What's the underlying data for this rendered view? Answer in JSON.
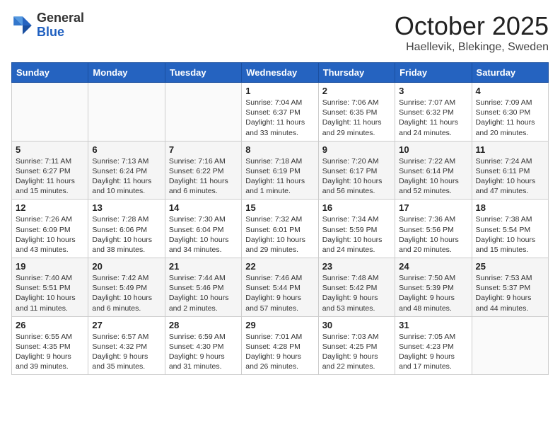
{
  "header": {
    "logo_general": "General",
    "logo_blue": "Blue",
    "month": "October 2025",
    "location": "Haellevik, Blekinge, Sweden"
  },
  "days_of_week": [
    "Sunday",
    "Monday",
    "Tuesday",
    "Wednesday",
    "Thursday",
    "Friday",
    "Saturday"
  ],
  "weeks": [
    {
      "shade": "white",
      "cells": [
        {
          "day": "",
          "empty": true,
          "text": ""
        },
        {
          "day": "",
          "empty": true,
          "text": ""
        },
        {
          "day": "",
          "empty": true,
          "text": ""
        },
        {
          "day": "1",
          "empty": false,
          "text": "Sunrise: 7:04 AM\nSunset: 6:37 PM\nDaylight: 11 hours\nand 33 minutes."
        },
        {
          "day": "2",
          "empty": false,
          "text": "Sunrise: 7:06 AM\nSunset: 6:35 PM\nDaylight: 11 hours\nand 29 minutes."
        },
        {
          "day": "3",
          "empty": false,
          "text": "Sunrise: 7:07 AM\nSunset: 6:32 PM\nDaylight: 11 hours\nand 24 minutes."
        },
        {
          "day": "4",
          "empty": false,
          "text": "Sunrise: 7:09 AM\nSunset: 6:30 PM\nDaylight: 11 hours\nand 20 minutes."
        }
      ]
    },
    {
      "shade": "gray",
      "cells": [
        {
          "day": "5",
          "empty": false,
          "text": "Sunrise: 7:11 AM\nSunset: 6:27 PM\nDaylight: 11 hours\nand 15 minutes."
        },
        {
          "day": "6",
          "empty": false,
          "text": "Sunrise: 7:13 AM\nSunset: 6:24 PM\nDaylight: 11 hours\nand 10 minutes."
        },
        {
          "day": "7",
          "empty": false,
          "text": "Sunrise: 7:16 AM\nSunset: 6:22 PM\nDaylight: 11 hours\nand 6 minutes."
        },
        {
          "day": "8",
          "empty": false,
          "text": "Sunrise: 7:18 AM\nSunset: 6:19 PM\nDaylight: 11 hours\nand 1 minute."
        },
        {
          "day": "9",
          "empty": false,
          "text": "Sunrise: 7:20 AM\nSunset: 6:17 PM\nDaylight: 10 hours\nand 56 minutes."
        },
        {
          "day": "10",
          "empty": false,
          "text": "Sunrise: 7:22 AM\nSunset: 6:14 PM\nDaylight: 10 hours\nand 52 minutes."
        },
        {
          "day": "11",
          "empty": false,
          "text": "Sunrise: 7:24 AM\nSunset: 6:11 PM\nDaylight: 10 hours\nand 47 minutes."
        }
      ]
    },
    {
      "shade": "white",
      "cells": [
        {
          "day": "12",
          "empty": false,
          "text": "Sunrise: 7:26 AM\nSunset: 6:09 PM\nDaylight: 10 hours\nand 43 minutes."
        },
        {
          "day": "13",
          "empty": false,
          "text": "Sunrise: 7:28 AM\nSunset: 6:06 PM\nDaylight: 10 hours\nand 38 minutes."
        },
        {
          "day": "14",
          "empty": false,
          "text": "Sunrise: 7:30 AM\nSunset: 6:04 PM\nDaylight: 10 hours\nand 34 minutes."
        },
        {
          "day": "15",
          "empty": false,
          "text": "Sunrise: 7:32 AM\nSunset: 6:01 PM\nDaylight: 10 hours\nand 29 minutes."
        },
        {
          "day": "16",
          "empty": false,
          "text": "Sunrise: 7:34 AM\nSunset: 5:59 PM\nDaylight: 10 hours\nand 24 minutes."
        },
        {
          "day": "17",
          "empty": false,
          "text": "Sunrise: 7:36 AM\nSunset: 5:56 PM\nDaylight: 10 hours\nand 20 minutes."
        },
        {
          "day": "18",
          "empty": false,
          "text": "Sunrise: 7:38 AM\nSunset: 5:54 PM\nDaylight: 10 hours\nand 15 minutes."
        }
      ]
    },
    {
      "shade": "gray",
      "cells": [
        {
          "day": "19",
          "empty": false,
          "text": "Sunrise: 7:40 AM\nSunset: 5:51 PM\nDaylight: 10 hours\nand 11 minutes."
        },
        {
          "day": "20",
          "empty": false,
          "text": "Sunrise: 7:42 AM\nSunset: 5:49 PM\nDaylight: 10 hours\nand 6 minutes."
        },
        {
          "day": "21",
          "empty": false,
          "text": "Sunrise: 7:44 AM\nSunset: 5:46 PM\nDaylight: 10 hours\nand 2 minutes."
        },
        {
          "day": "22",
          "empty": false,
          "text": "Sunrise: 7:46 AM\nSunset: 5:44 PM\nDaylight: 9 hours\nand 57 minutes."
        },
        {
          "day": "23",
          "empty": false,
          "text": "Sunrise: 7:48 AM\nSunset: 5:42 PM\nDaylight: 9 hours\nand 53 minutes."
        },
        {
          "day": "24",
          "empty": false,
          "text": "Sunrise: 7:50 AM\nSunset: 5:39 PM\nDaylight: 9 hours\nand 48 minutes."
        },
        {
          "day": "25",
          "empty": false,
          "text": "Sunrise: 7:53 AM\nSunset: 5:37 PM\nDaylight: 9 hours\nand 44 minutes."
        }
      ]
    },
    {
      "shade": "white",
      "cells": [
        {
          "day": "26",
          "empty": false,
          "text": "Sunrise: 6:55 AM\nSunset: 4:35 PM\nDaylight: 9 hours\nand 39 minutes."
        },
        {
          "day": "27",
          "empty": false,
          "text": "Sunrise: 6:57 AM\nSunset: 4:32 PM\nDaylight: 9 hours\nand 35 minutes."
        },
        {
          "day": "28",
          "empty": false,
          "text": "Sunrise: 6:59 AM\nSunset: 4:30 PM\nDaylight: 9 hours\nand 31 minutes."
        },
        {
          "day": "29",
          "empty": false,
          "text": "Sunrise: 7:01 AM\nSunset: 4:28 PM\nDaylight: 9 hours\nand 26 minutes."
        },
        {
          "day": "30",
          "empty": false,
          "text": "Sunrise: 7:03 AM\nSunset: 4:25 PM\nDaylight: 9 hours\nand 22 minutes."
        },
        {
          "day": "31",
          "empty": false,
          "text": "Sunrise: 7:05 AM\nSunset: 4:23 PM\nDaylight: 9 hours\nand 17 minutes."
        },
        {
          "day": "",
          "empty": true,
          "text": ""
        }
      ]
    }
  ]
}
